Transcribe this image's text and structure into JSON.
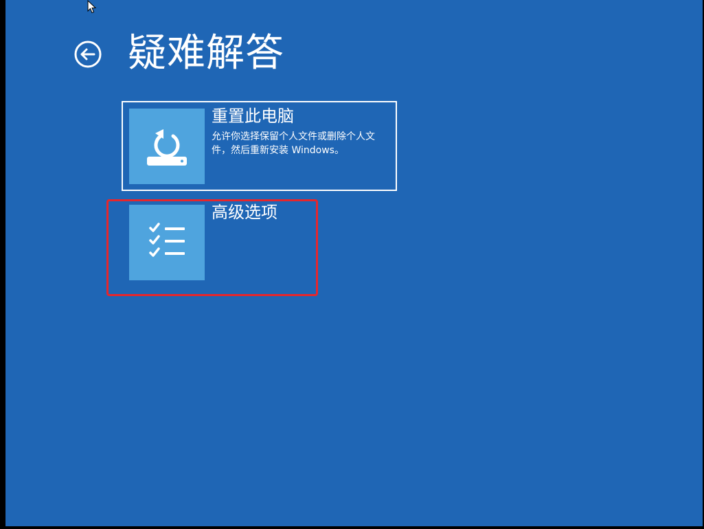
{
  "header": {
    "title": "疑难解答",
    "back_icon": "back-arrow-circle-icon"
  },
  "options": [
    {
      "title": "重置此电脑",
      "description": "允许你选择保留个人文件或删除个人文件，然后重新安装 Windows。",
      "icon": "reset-pc-icon",
      "selected": true
    },
    {
      "title": "高级选项",
      "description": "",
      "icon": "checklist-icon",
      "selected": false
    }
  ],
  "colors": {
    "background": "#1f66b5",
    "tile": "#4fa4de",
    "text": "#ffffff",
    "highlight": "#e8262b"
  }
}
